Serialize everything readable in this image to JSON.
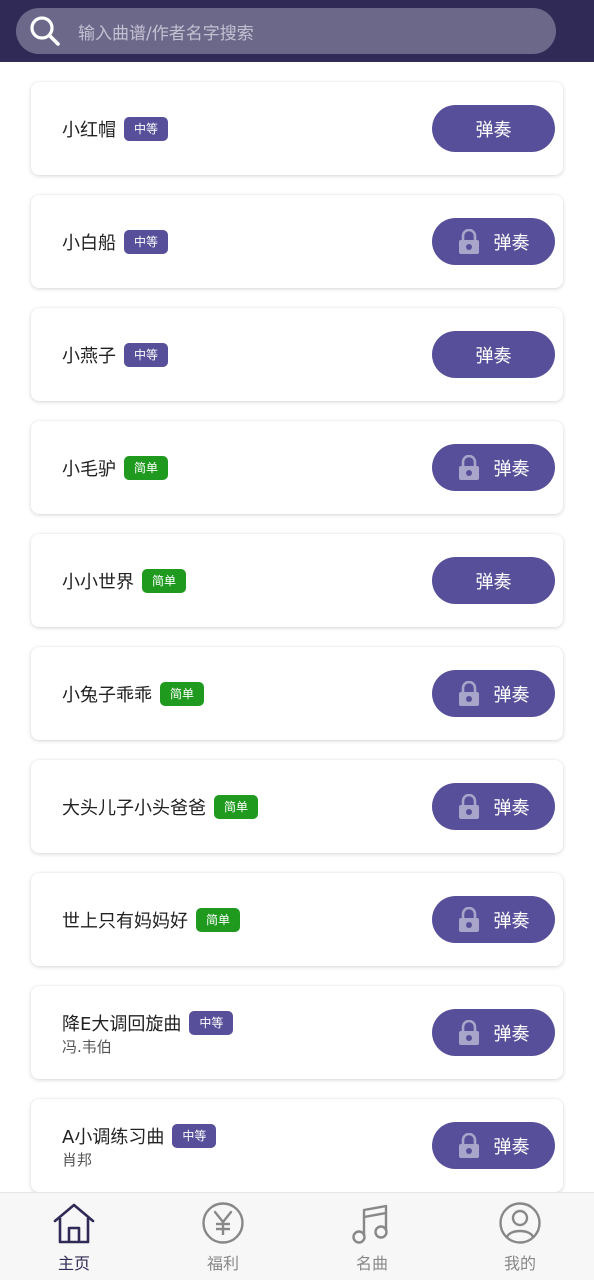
{
  "search": {
    "placeholder": "输入曲谱/作者名字搜索"
  },
  "play_label": "弹奏",
  "songs": [
    {
      "title": "小红帽",
      "level": "中等",
      "composer": ""
    },
    {
      "title": "小白船",
      "level": "中等",
      "composer": ""
    },
    {
      "title": "小燕子",
      "level": "中等",
      "composer": ""
    },
    {
      "title": "小毛驴",
      "level": "简单",
      "composer": ""
    },
    {
      "title": "小小世界",
      "level": "简单",
      "composer": ""
    },
    {
      "title": "小兔子乖乖",
      "level": "简单",
      "composer": ""
    },
    {
      "title": "大头儿子小头爸爸",
      "level": "简单",
      "composer": ""
    },
    {
      "title": "世上只有妈妈好",
      "level": "简单",
      "composer": ""
    },
    {
      "title": "降E大调回旋曲",
      "level": "中等",
      "composer": "冯.韦伯"
    },
    {
      "title": "A小调练习曲",
      "level": "中等",
      "composer": "肖邦"
    }
  ],
  "nav": {
    "home": "主页",
    "welfare": "福利",
    "famous": "名曲",
    "mine": "我的"
  },
  "colors": {
    "header_bg": "#2f2a56",
    "accent": "#584f9a",
    "easy_badge": "#1f9a1f"
  }
}
